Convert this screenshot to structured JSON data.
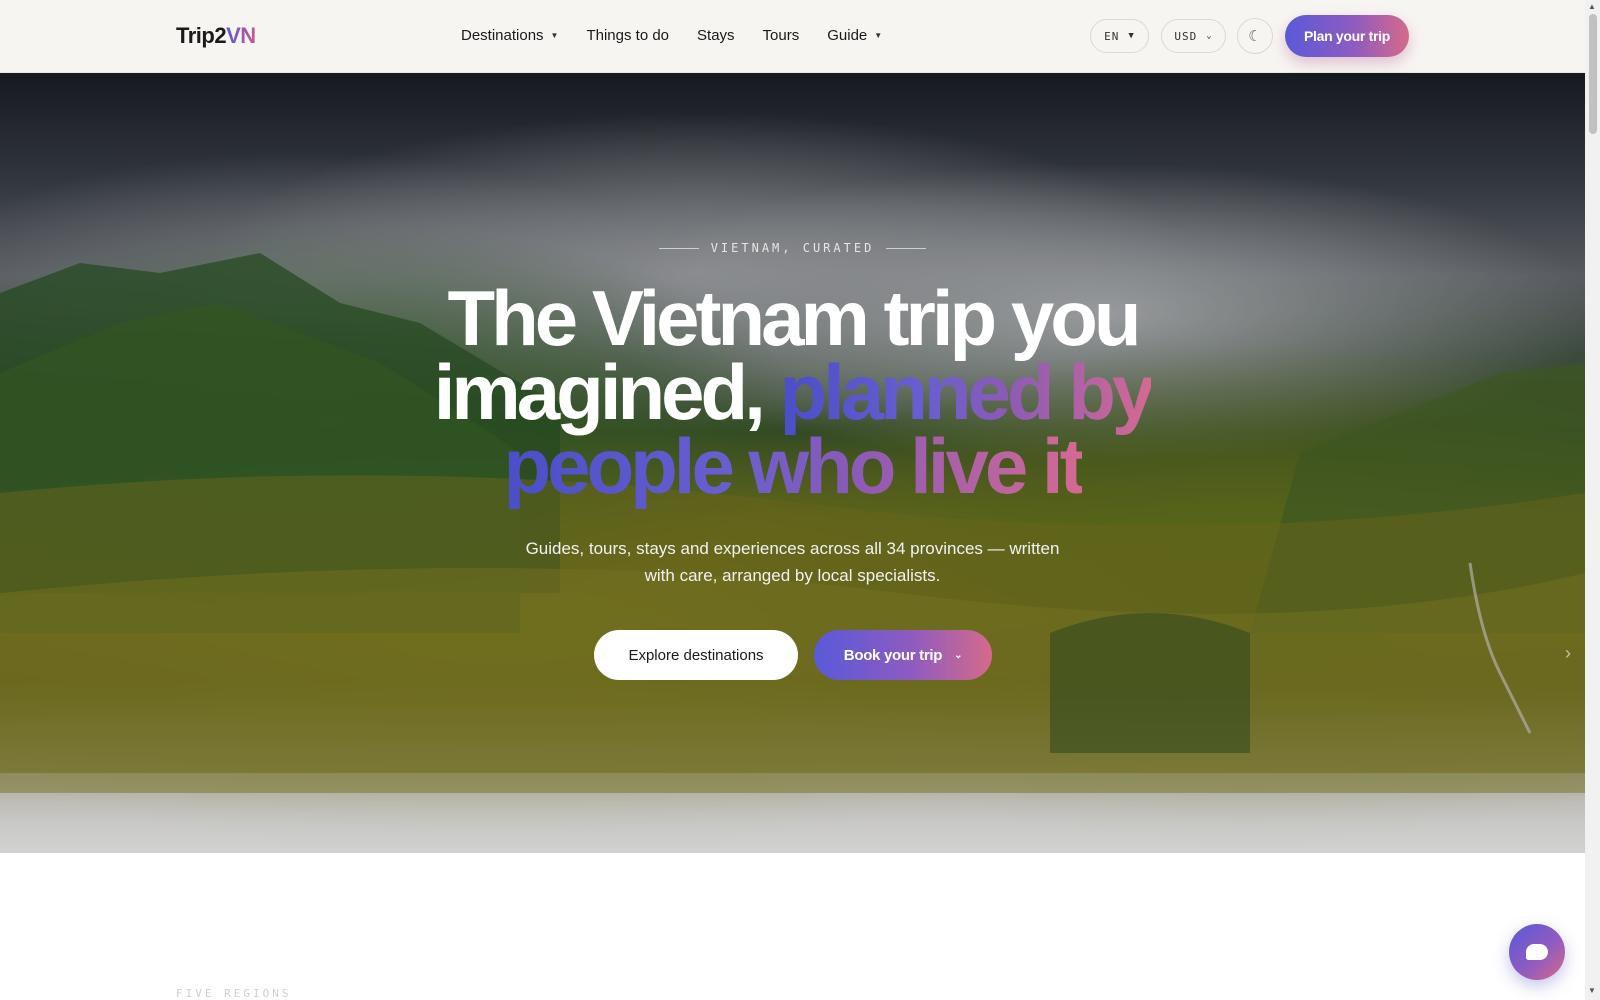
{
  "header": {
    "logo_main": "Trip2",
    "logo_accent": "VN",
    "nav": [
      {
        "label": "Destinations",
        "has_caret": true
      },
      {
        "label": "Things to do",
        "has_caret": false
      },
      {
        "label": "Stays",
        "has_caret": false
      },
      {
        "label": "Tours",
        "has_caret": false
      },
      {
        "label": "Guide",
        "has_caret": true
      }
    ],
    "language": "EN",
    "currency": "USD",
    "theme_toggle_icon": "moon-icon",
    "plan_button": "Plan your trip"
  },
  "hero": {
    "eyebrow": "VIETNAM, CURATED",
    "headline_line1": "The Vietnam trip you",
    "headline_line2_plain": "imagined,",
    "headline_line2_grad": "planned by",
    "headline_line3_grad": "people who live it",
    "subtitle_line1": "Guides, tours, stays and experiences across all 34 provinces — written",
    "subtitle_line2": "with care, arranged by local specialists.",
    "explore_button": "Explore destinations",
    "book_button": "Book your trip"
  },
  "section": {
    "eyebrow": "FIVE REGIONS"
  },
  "colors": {
    "accent_start": "#5a5ad8",
    "accent_mid": "#8e5bc0",
    "accent_end": "#d56a8a",
    "header_bg": "#f7f5f2"
  }
}
